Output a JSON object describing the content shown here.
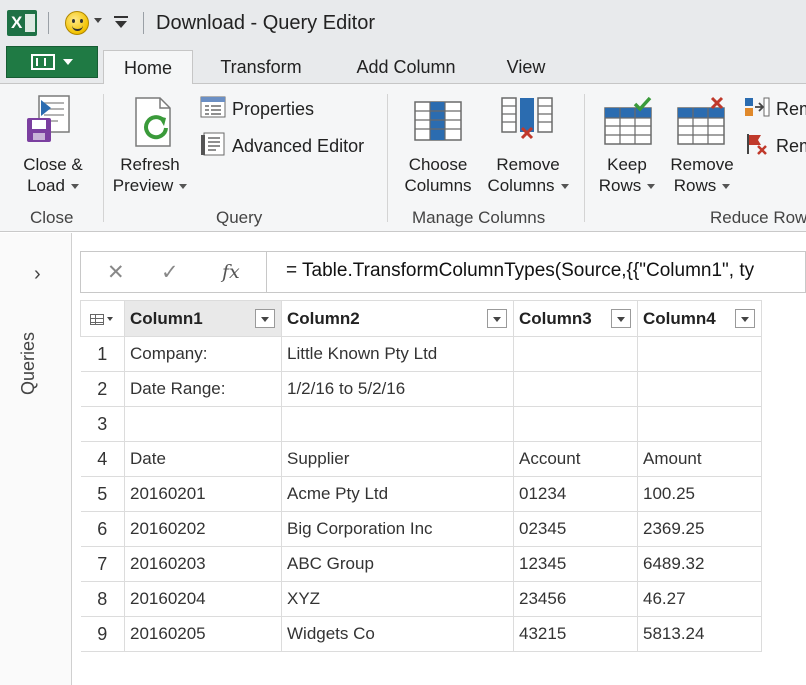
{
  "titlebar": {
    "app_icon": "excel-logo-icon",
    "app_icon_text": "X",
    "title": "Download - Query Editor"
  },
  "tabs": {
    "file": "file-menu-icon",
    "items": [
      "Home",
      "Transform",
      "Add Column",
      "View"
    ],
    "active": "Home"
  },
  "ribbon": {
    "close_load": {
      "line1": "Close &",
      "line2": "Load"
    },
    "refresh_preview": {
      "line1": "Refresh",
      "line2": "Preview"
    },
    "properties": "Properties",
    "advanced_editor": "Advanced Editor",
    "choose_columns": {
      "line1": "Choose",
      "line2": "Columns"
    },
    "remove_columns": {
      "line1": "Remove",
      "line2": "Columns"
    },
    "keep_rows": {
      "line1": "Keep",
      "line2": "Rows"
    },
    "remove_rows": {
      "line1": "Remove",
      "line2": "Rows"
    },
    "rem1": "Rem",
    "rem2": "Rem",
    "groups": {
      "close": "Close",
      "query": "Query",
      "manage_columns": "Manage Columns",
      "reduce_rows": "Reduce Row"
    }
  },
  "queries_pane": {
    "label": "Queries",
    "chevron": "›"
  },
  "formula_bar": {
    "cancel": "✕",
    "confirm": "✓",
    "fx": "fx",
    "formula": "= Table.TransformColumnTypes(Source,{{\"Column1\", ty"
  },
  "table": {
    "columns": [
      "Column1",
      "Column2",
      "Column3",
      "Column4"
    ],
    "rows": [
      {
        "n": "1",
        "c1": "Company:",
        "c2": "Little Known Pty Ltd",
        "c3": "",
        "c4": ""
      },
      {
        "n": "2",
        "c1": "Date Range:",
        "c2": "1/2/16 to 5/2/16",
        "c3": "",
        "c4": ""
      },
      {
        "n": "3",
        "c1": "",
        "c2": "",
        "c3": "",
        "c4": ""
      },
      {
        "n": "4",
        "c1": "Date",
        "c2": "Supplier",
        "c3": "Account",
        "c4": "Amount"
      },
      {
        "n": "5",
        "c1": "20160201",
        "c2": "Acme Pty Ltd",
        "c3": "01234",
        "c4": "100.25"
      },
      {
        "n": "6",
        "c1": "20160202",
        "c2": "Big Corporation Inc",
        "c3": "02345",
        "c4": "2369.25"
      },
      {
        "n": "7",
        "c1": "20160203",
        "c2": "ABC Group",
        "c3": "12345",
        "c4": "6489.32"
      },
      {
        "n": "8",
        "c1": "20160204",
        "c2": "XYZ",
        "c3": "23456",
        "c4": "46.27"
      },
      {
        "n": "9",
        "c1": "20160205",
        "c2": "Widgets Co",
        "c3": "43215",
        "c4": "5813.24"
      }
    ]
  },
  "colors": {
    "excel_green": "#1e7145",
    "file_tab_green": "#1f7a44",
    "ribbon_bg": "#f5f6f7",
    "chrome_bg": "#e8eaec",
    "accent_blue": "#2b6cb0",
    "accent_red": "#c0392b"
  }
}
